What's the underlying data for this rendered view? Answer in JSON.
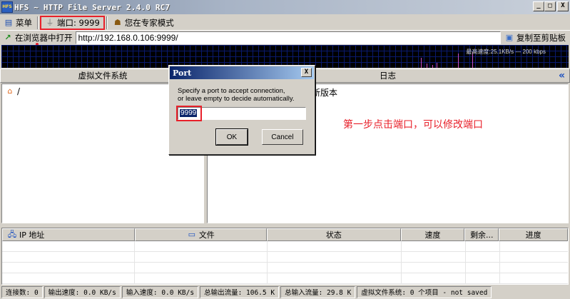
{
  "window": {
    "title": "HFS ~ HTTP File Server 2.4.0 RC7",
    "app_icon_text": "HFS",
    "minimize": "_",
    "maximize": "□",
    "close": "X"
  },
  "toolbar": {
    "menu": "菜单",
    "port": "端口: 9999",
    "expert": "您在专家模式"
  },
  "urlbar": {
    "open_in_browser": "在浏览器中打开",
    "url": "http://192.168.0.106:9999/",
    "copy": "复制至剪贴板"
  },
  "graph": {
    "label": "最高速度:25.1KB/s  ---  200 kbps"
  },
  "panels": {
    "vfs_header": "虚拟文件系统",
    "log_header": "日志",
    "collapse": "«",
    "vfs_root": "/",
    "log_line": "新版本"
  },
  "annotation": "第一步点击端口，可以修改端口",
  "dialog": {
    "title": "Port",
    "close": "X",
    "line1": "Specify a port to accept connection,",
    "line2": "or leave empty to decide automatically.",
    "value": "9999",
    "ok": "OK",
    "cancel": "Cancel"
  },
  "connections": {
    "columns": [
      "IP 地址",
      "文件",
      "状态",
      "速度",
      "剩余...",
      "进度"
    ]
  },
  "statusbar": {
    "connections": "连接数: 0",
    "out_speed": "输出速度: 0.0 KB/s",
    "in_speed": "输入速度: 0.0 KB/s",
    "total_out": "总输出流量: 106.5 K",
    "total_in": "总输入流量: 29.8 K",
    "vfs": "虚拟文件系统: 0 个项目 - not saved"
  },
  "colors": {
    "highlight": "#e8202a",
    "title_active": "#0a246a",
    "face": "#d4d0c8",
    "graph_bg": "#000000"
  }
}
